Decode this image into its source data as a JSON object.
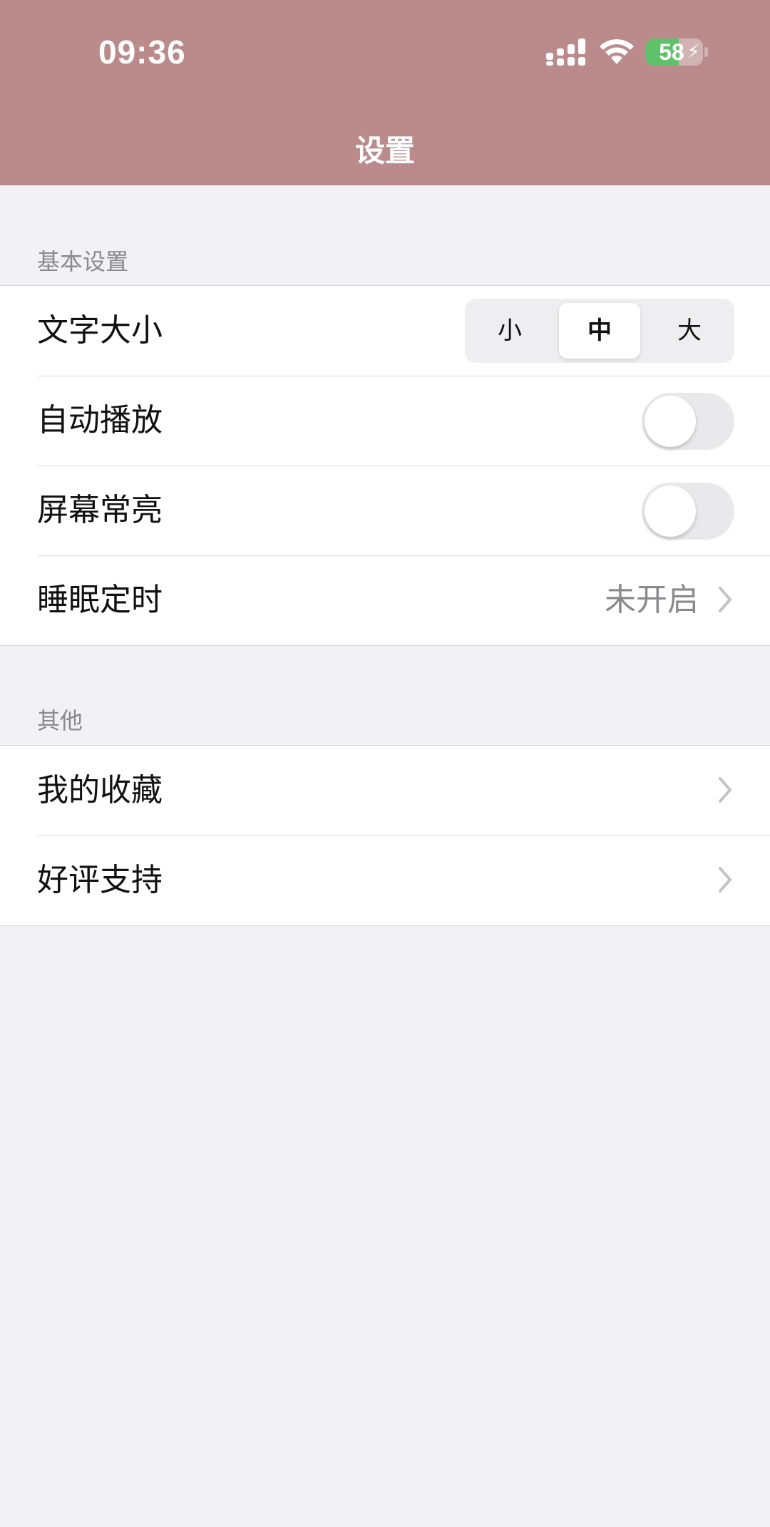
{
  "status_bar": {
    "time": "09:36",
    "battery_level": "58"
  },
  "nav": {
    "title": "设置"
  },
  "sections": [
    {
      "label": "基本设置",
      "rows": {
        "font_size": {
          "label": "文字大小",
          "options": [
            "小",
            "中",
            "大"
          ],
          "selected": "中"
        },
        "autoplay": {
          "label": "自动播放",
          "on": false
        },
        "screen_on": {
          "label": "屏幕常亮",
          "on": false
        },
        "sleep_timer": {
          "label": "睡眠定时",
          "value": "未开启"
        }
      }
    },
    {
      "label": "其他",
      "rows": {
        "favorites": {
          "label": "我的收藏"
        },
        "rate": {
          "label": "好评支持"
        }
      }
    }
  ],
  "colors": {
    "header": "#bb8b8b",
    "background": "#f2f1f6",
    "battery_fill": "#5fc16a"
  },
  "icons": {
    "signal": "cellular-signal-icon",
    "wifi": "wifi-icon",
    "battery": "battery-charging-icon",
    "chevron": "chevron-right-icon"
  }
}
